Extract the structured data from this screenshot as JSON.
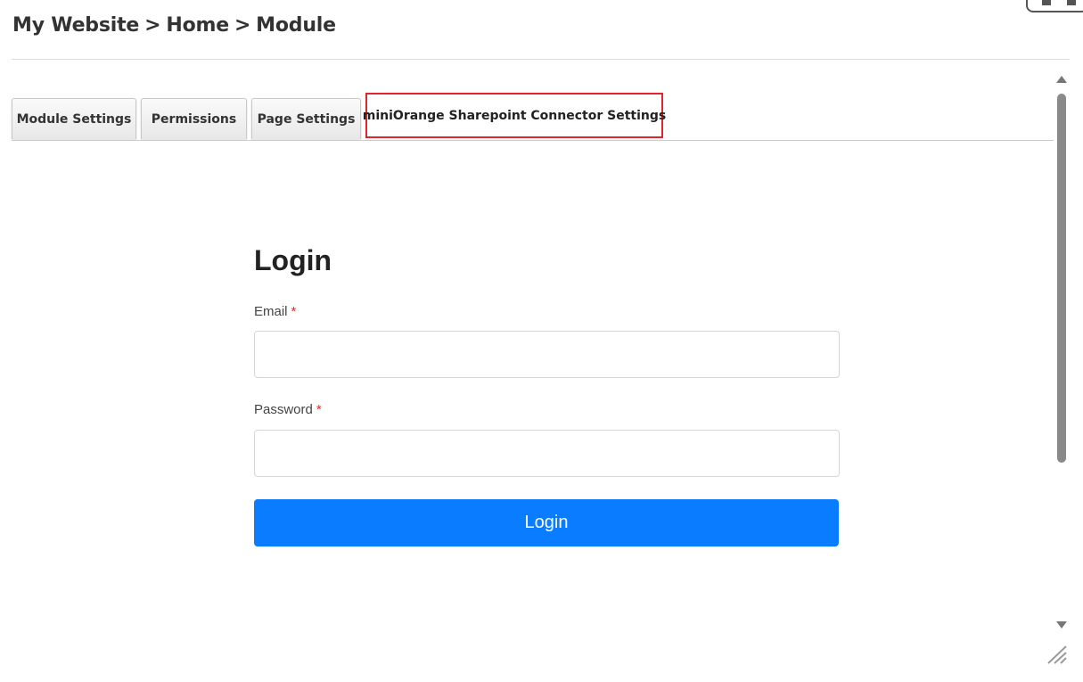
{
  "breadcrumb": {
    "items": [
      "My Website",
      "Home",
      "Module"
    ],
    "separator": ">"
  },
  "tabs": [
    {
      "label": "Module Settings",
      "active": false
    },
    {
      "label": "Permissions",
      "active": false
    },
    {
      "label": "Page Settings",
      "active": false
    },
    {
      "label": "miniOrange Sharepoint Connector Settings",
      "active": true
    }
  ],
  "login": {
    "title": "Login",
    "email_label": "Email",
    "email_value": "",
    "password_label": "Password",
    "password_value": "",
    "required_marker": "*",
    "button_label": "Login"
  },
  "icons": {
    "scroll_up": "triangle-up-icon",
    "scroll_down": "triangle-down-icon",
    "resize": "resize-grip-icon"
  },
  "colors": {
    "primary_button": "#0a7cff",
    "active_tab_border": "#e0262b",
    "required_marker": "#d33333"
  }
}
